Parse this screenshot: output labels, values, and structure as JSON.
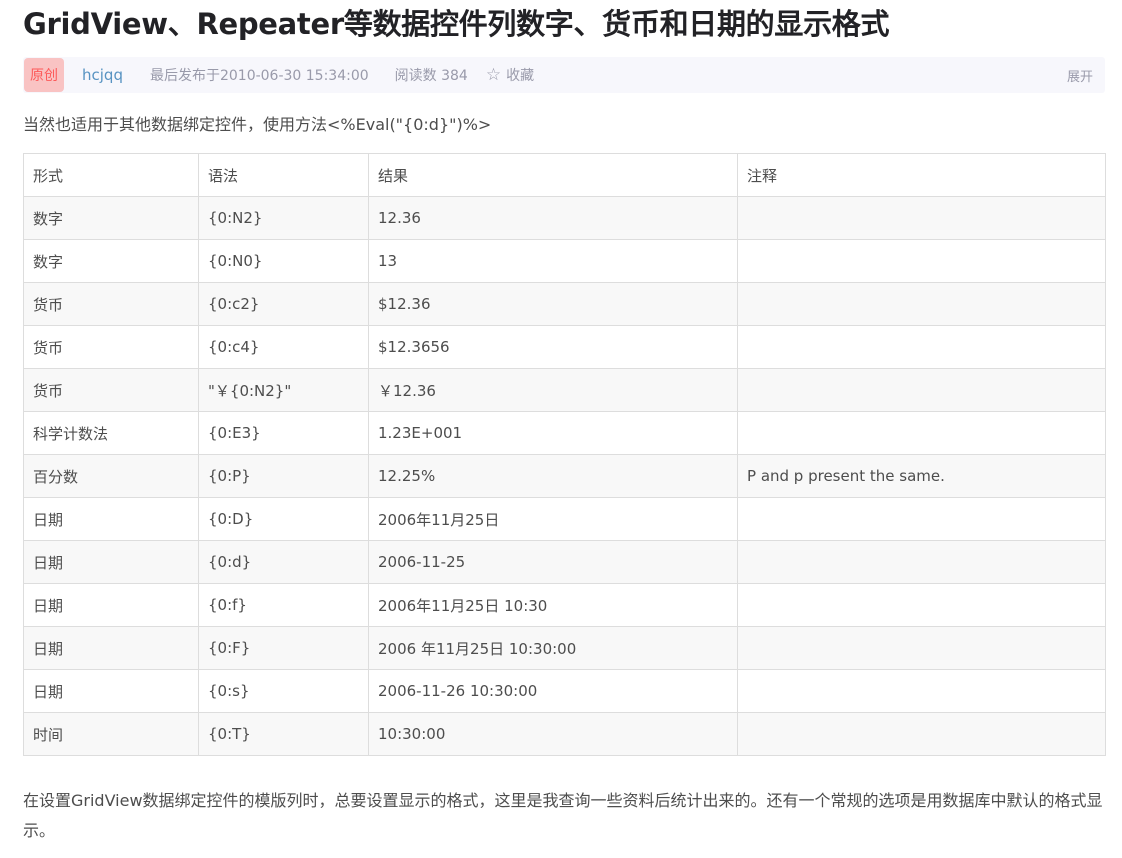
{
  "article": {
    "title": "GridView、Repeater等数据控件列数字、货币和日期的显示格式",
    "badge": "原创",
    "author": "hcjqq",
    "published": "最后发布于2010-06-30 15:34:00",
    "reads": "阅读数 384",
    "favorite": "收藏",
    "expand": "展开",
    "intro": "当然也适用于其他数据绑定控件，使用方法<%Eval(\"{0:d}\")%>",
    "outro": "在设置GridView数据绑定控件的模版列时，总要设置显示的格式，这里是我查询一些资料后统计出来的。还有一个常规的选项是用数据库中默认的格式显示。"
  },
  "icons": {
    "favorite": "star-outline-icon"
  },
  "colors": {
    "badge_bg": "#f9c3c3",
    "badge_text": "#fd5a5a",
    "author": "#5893c2",
    "meta_bg": "#f7f7fc"
  },
  "table": {
    "headers": [
      "形式",
      "语法",
      "结果",
      "注释"
    ],
    "rows": [
      [
        "数字",
        "{0:N2}",
        "12.36",
        ""
      ],
      [
        "数字",
        "{0:N0}",
        "13",
        ""
      ],
      [
        "货币",
        "{0:c2}",
        "$12.36",
        ""
      ],
      [
        "货币",
        "{0:c4}",
        "$12.3656",
        ""
      ],
      [
        "货币",
        "\"￥{0:N2}\"",
        "￥12.36",
        ""
      ],
      [
        "科学计数法",
        "{0:E3}",
        "1.23E+001",
        ""
      ],
      [
        "百分数",
        "{0:P}",
        "12.25%",
        "P and p present the same."
      ],
      [
        "日期",
        "{0:D}",
        "2006年11月25日",
        ""
      ],
      [
        "日期",
        "{0:d}",
        "2006-11-25",
        ""
      ],
      [
        "日期",
        "{0:f}",
        "2006年11月25日 10:30",
        ""
      ],
      [
        "日期",
        "{0:F}",
        "2006 年11月25日 10:30:00",
        ""
      ],
      [
        "日期",
        "{0:s}",
        "2006-11-26 10:30:00",
        ""
      ],
      [
        "时间",
        "{0:T}",
        "10:30:00",
        ""
      ]
    ]
  }
}
